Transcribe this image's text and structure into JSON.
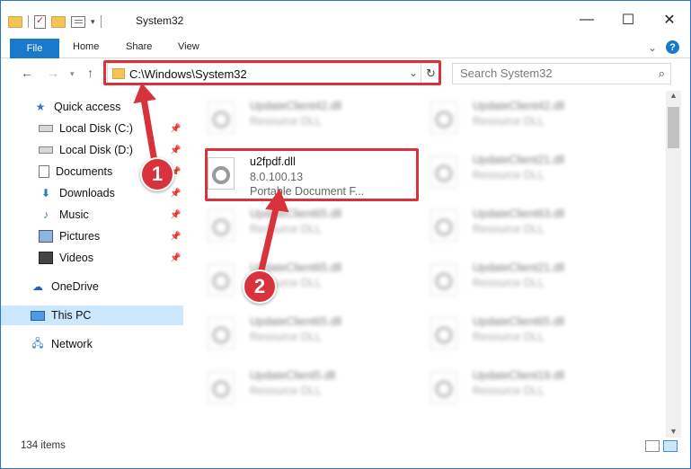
{
  "window": {
    "title": "System32",
    "controls": {
      "minimize": "—",
      "maximize": "☐",
      "close": "✕"
    }
  },
  "ribbon": {
    "tabs": [
      {
        "label": "File"
      },
      {
        "label": "Home"
      },
      {
        "label": "Share"
      },
      {
        "label": "View"
      }
    ],
    "help": "?"
  },
  "address": {
    "path": "C:\\Windows\\System32",
    "search_placeholder": "Search System32"
  },
  "sidebar": {
    "items": [
      {
        "label": "Quick access",
        "icon": "star-icon",
        "pinned": false
      },
      {
        "label": "Local Disk (C:)",
        "icon": "drive-icon",
        "pinned": true
      },
      {
        "label": "Local Disk (D:)",
        "icon": "drive-icon",
        "pinned": true
      },
      {
        "label": "Documents",
        "icon": "document-icon",
        "pinned": true
      },
      {
        "label": "Downloads",
        "icon": "download-icon",
        "pinned": true
      },
      {
        "label": "Music",
        "icon": "music-icon",
        "pinned": true
      },
      {
        "label": "Pictures",
        "icon": "pictures-icon",
        "pinned": true
      },
      {
        "label": "Videos",
        "icon": "video-icon",
        "pinned": true
      },
      {
        "label": "OneDrive",
        "icon": "cloud-icon",
        "pinned": false
      },
      {
        "label": "This PC",
        "icon": "computer-icon",
        "pinned": false,
        "selected": true
      },
      {
        "label": "Network",
        "icon": "network-icon",
        "pinned": false
      }
    ]
  },
  "files": {
    "highlighted": {
      "name": "u2fpdf.dll",
      "version": "8.0.100.13",
      "type": "Portable Document F..."
    },
    "left_column": [
      {
        "name": "UpdateClient42.dll",
        "type": "Resource DLL"
      },
      {
        "name": "UpdateClient65.dll",
        "type": "Resource DLL"
      },
      {
        "name": "UpdateClient65.dll",
        "type": "Resource DLL"
      },
      {
        "name": "UpdateClient65.dll",
        "type": "Resource DLL"
      },
      {
        "name": "UpdateClient5.dll",
        "type": "Resource DLL"
      }
    ],
    "right_column": [
      {
        "name": "UpdateClient42.dll",
        "type": "Resource DLL"
      },
      {
        "name": "UpdateClient21.dll",
        "type": "Resource DLL"
      },
      {
        "name": "UpdateClient63.dll",
        "type": "Resource DLL"
      },
      {
        "name": "UpdateClient21.dll",
        "type": "Resource DLL"
      },
      {
        "name": "UpdateClient65.dll",
        "type": "Resource DLL"
      },
      {
        "name": "UpdateClient19.dll",
        "type": "Resource DLL"
      }
    ]
  },
  "status": {
    "item_count": "134 items"
  },
  "annotations": {
    "step1": "1",
    "step2": "2",
    "color": "#d8323c"
  }
}
